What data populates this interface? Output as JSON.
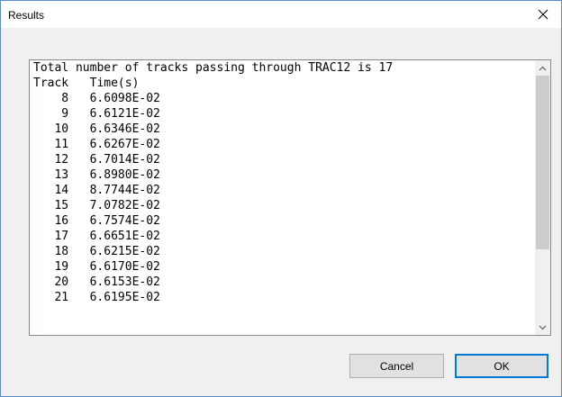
{
  "window": {
    "title": "Results",
    "close_icon": "close-icon"
  },
  "output": {
    "header_line": "Total number of tracks passing through TRAC12 is 17",
    "column_headers": [
      "Track",
      "Time(s)"
    ],
    "rows": [
      {
        "track": "8",
        "time": "6.6098E-02"
      },
      {
        "track": "9",
        "time": "6.6121E-02"
      },
      {
        "track": "10",
        "time": "6.6346E-02"
      },
      {
        "track": "11",
        "time": "6.6267E-02"
      },
      {
        "track": "12",
        "time": "6.7014E-02"
      },
      {
        "track": "13",
        "time": "6.8980E-02"
      },
      {
        "track": "14",
        "time": "8.7744E-02"
      },
      {
        "track": "15",
        "time": "7.0782E-02"
      },
      {
        "track": "16",
        "time": "6.7574E-02"
      },
      {
        "track": "17",
        "time": "6.6651E-02"
      },
      {
        "track": "18",
        "time": "6.6215E-02"
      },
      {
        "track": "19",
        "time": "6.6170E-02"
      },
      {
        "track": "20",
        "time": "6.6153E-02"
      },
      {
        "track": "21",
        "time": "6.6195E-02"
      }
    ]
  },
  "buttons": {
    "cancel_label": "Cancel",
    "ok_label": "OK"
  }
}
